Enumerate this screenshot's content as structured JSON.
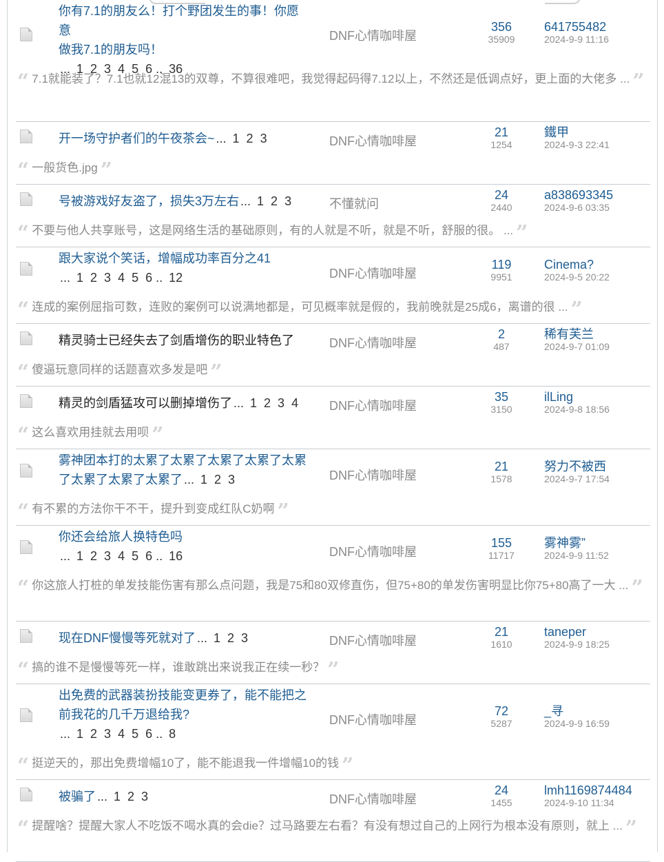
{
  "threads": [
    {
      "title": "你有7.1的朋友么！打个野团发生的事！你愿意做我7.1的朋友吗！",
      "title_lines": [
        "你有7.1的朋友么！打个野团发生的事！你愿意",
        "做我7.1的朋友吗！"
      ],
      "pages": [
        "1",
        "2",
        "3",
        "4",
        "5",
        "6"
      ],
      "last_page": "36",
      "forum": "DNF心情咖啡屋",
      "replies": "356",
      "views": "35909",
      "author": "641755482",
      "time": "2024-9-9 11:16",
      "quote": "7.1就能装了？7.1也就12混13的双尊，不算很难吧，我觉得起码得7.12以上，不然还是低调点好，更上面的大佬多 ..."
    },
    {
      "title": "开一场守护者们的午夜茶会~",
      "pages": [
        "1",
        "2",
        "3"
      ],
      "forum": "DNF心情咖啡屋",
      "replies": "21",
      "views": "1254",
      "author": "鐵甲",
      "time": "2024-9-3 22:41",
      "quote": "一般货色.jpg"
    },
    {
      "title": "号被游戏好友盗了，损失3万左右",
      "pages": [
        "1",
        "2",
        "3"
      ],
      "forum": "不懂就问",
      "replies": "24",
      "views": "2440",
      "author": "a838693345",
      "time": "2024-9-6 03:35",
      "quote": "不要与他人共享账号，这是网络生活的基础原则，有的人就是不听，就是不听，舒服的很。 ..."
    },
    {
      "title": "跟大家说个笑话，增幅成功率百分之41",
      "pages": [
        "1",
        "2",
        "3",
        "4",
        "5",
        "6"
      ],
      "last_page": "12",
      "forum": "DNF心情咖啡屋",
      "replies": "119",
      "views": "9951",
      "author": "Cinema?",
      "time": "2024-9-5 20:22",
      "quote": "连成的案例屈指可数，连败的案例可以说满地都是，可见概率就是假的，我前晚就是25成6，离谱的很 ..."
    },
    {
      "title": "精灵骑士已经失去了剑盾增伤的职业特色了",
      "visited": true,
      "forum": "DNF心情咖啡屋",
      "replies": "2",
      "views": "487",
      "author": "稀有芙兰",
      "time": "2024-9-7 01:09",
      "quote": "傻逼玩意同样的话题喜欢多发是吧"
    },
    {
      "title": "精灵的剑盾猛攻可以删掉增伤了",
      "visited": true,
      "pages": [
        "1",
        "2",
        "3",
        "4"
      ],
      "forum": "DNF心情咖啡屋",
      "replies": "35",
      "views": "3150",
      "author": "ilLing",
      "time": "2024-9-8 18:56",
      "quote": "这么喜欢用挂就去用呗"
    },
    {
      "title": "雾神团本打的太累了太累了太累了太累了太累了太累了太累了太累了",
      "title_lines": [
        "雾神团本打的太累了太累了太累了太累了太累",
        "了太累了太累了太累了"
      ],
      "pages": [
        "1",
        "2",
        "3"
      ],
      "forum": "DNF心情咖啡屋",
      "replies": "21",
      "views": "1578",
      "author": "努力不被西",
      "time": "2024-9-7 17:54",
      "quote": "有不累的方法你干不干，提升到变成红队C奶啊"
    },
    {
      "title": "你还会给旅人换特色吗",
      "pages": [
        "1",
        "2",
        "3",
        "4",
        "5",
        "6"
      ],
      "last_page": "16",
      "forum": "DNF心情咖啡屋",
      "replies": "155",
      "views": "11717",
      "author": "雾神雾”",
      "time": "2024-9-9 11:52",
      "quote": "你这旅人打桩的单发技能伤害有那么点问题，我是75和80双修直伤，但75+80的单发伤害明显比你75+80高了一大 ..."
    },
    {
      "title": "现在DNF慢慢等死就对了",
      "pages": [
        "1",
        "2",
        "3"
      ],
      "forum": "DNF心情咖啡屋",
      "replies": "21",
      "views": "1610",
      "author": "taneper",
      "time": "2024-9-9 18:25",
      "quote": "搞的谁不是慢慢等死一样，谁敢跳出来说我正在续一秒？"
    },
    {
      "title": "出免费的武器装扮技能变更券了，能不能把之前我花的几千万退给我?",
      "title_lines": [
        "出免费的武器装扮技能变更券了，能不能把之",
        "前我花的几千万退给我?"
      ],
      "pages": [
        "1",
        "2",
        "3",
        "4",
        "5",
        "6"
      ],
      "last_page": "8",
      "forum": "DNF心情咖啡屋",
      "replies": "72",
      "views": "5287",
      "author": "_寻",
      "time": "2024-9-9 16:59",
      "quote": "挺逆天的，那出免费增幅10了，能不能退我一件增幅10的钱"
    },
    {
      "title": "被骗了",
      "pages": [
        "1",
        "2",
        "3"
      ],
      "forum": "DNF心情咖啡屋",
      "replies": "24",
      "views": "1455",
      "author": "lmh1169874484",
      "time": "2024-9-10 11:34",
      "quote": "提醒啥？提醒大家人不吃饭不喝水真的会die？过马路要左右看？有没有想过自己的上网行为根本没有原则，就上 ..."
    }
  ],
  "colors": {
    "link": "#1f5d92",
    "muted": "#8a8a8a",
    "divider": "#c7ccd1"
  },
  "icons": {
    "thread": "document-icon",
    "quote_open": "quote-open-icon",
    "quote_close": "quote-close-icon"
  }
}
